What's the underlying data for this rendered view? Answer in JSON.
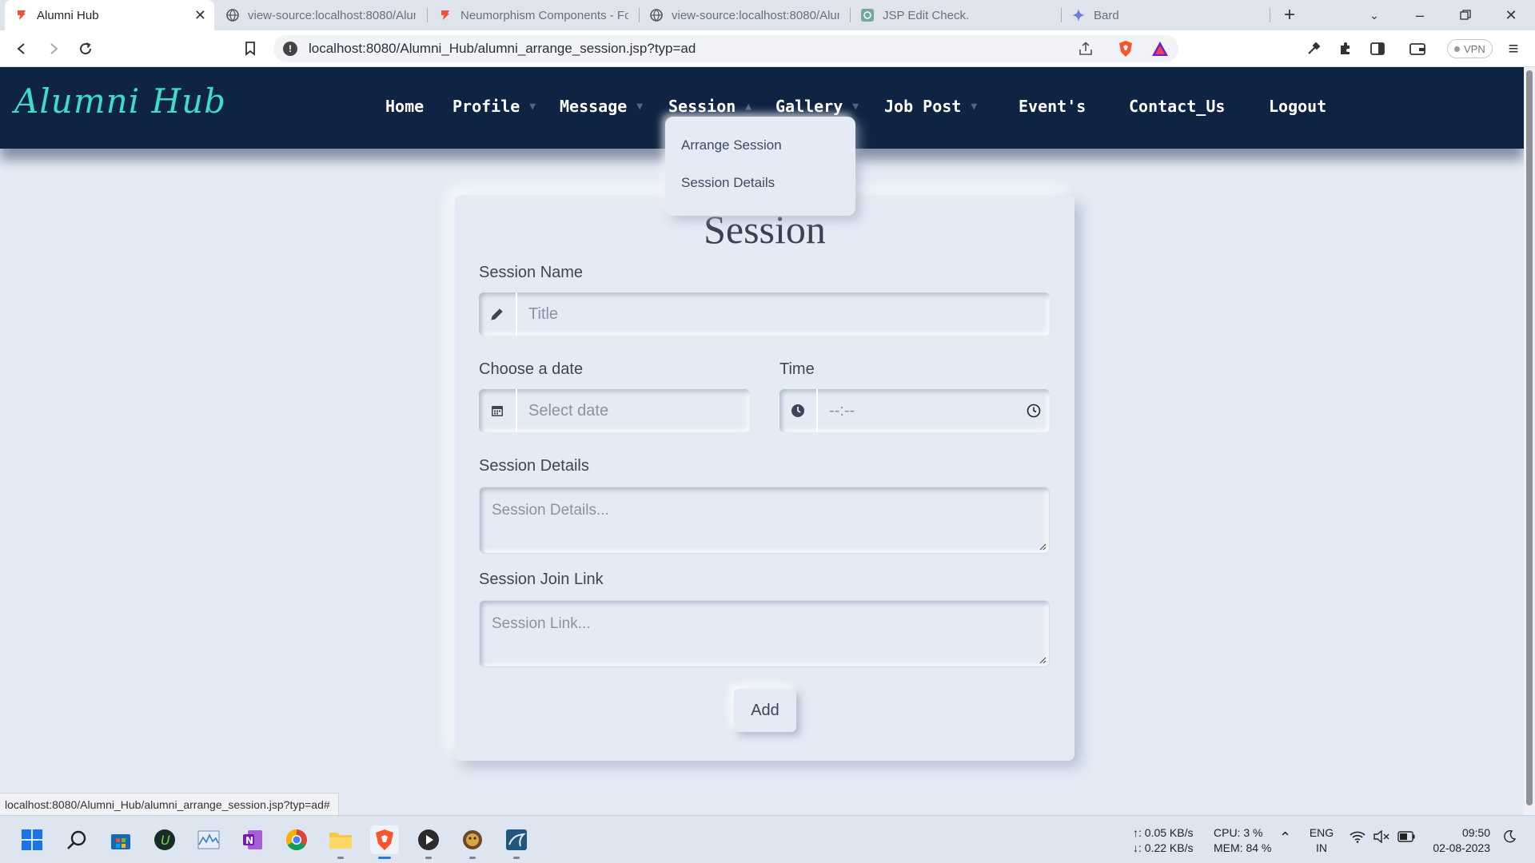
{
  "browser": {
    "tabs": [
      {
        "title": "Alumni Hub",
        "active": true
      },
      {
        "title": "view-source:localhost:8080/Alum"
      },
      {
        "title": "Neumorphism Components - Fo"
      },
      {
        "title": "view-source:localhost:8080/Alum"
      },
      {
        "title": "JSP Edit Check."
      },
      {
        "title": "Bard"
      }
    ],
    "url": "localhost:8080/Alumni_Hub/alumni_arrange_session.jsp?typ=ad",
    "vpn_label": "VPN",
    "status_url": "localhost:8080/Alumni_Hub/alumni_arrange_session.jsp?typ=ad#"
  },
  "site": {
    "logo": "Alumni Hub",
    "nav": [
      "Home",
      "Profile",
      "Message",
      "Session",
      "Gallery",
      "Job Post",
      "Event's",
      "Contact_Us",
      "Logout"
    ],
    "dropdown": [
      "Arrange Session",
      "Session Details"
    ]
  },
  "form": {
    "title": "Session",
    "session_name_label": "Session Name",
    "session_name_placeholder": "Title",
    "date_label": "Choose a date",
    "date_placeholder": "Select date",
    "time_label": "Time",
    "time_placeholder": "--:--",
    "details_label": "Session Details",
    "details_placeholder": "Session Details...",
    "link_label": "Session Join Link",
    "link_placeholder": "Session Link...",
    "add_button": "Add"
  },
  "taskbar": {
    "net_up": "↑: 0.05 KB/s",
    "net_down": "↓: 0.22 KB/s",
    "cpu": "CPU: 3 %",
    "mem": "MEM: 84 %",
    "lang": "ENG",
    "region": "IN",
    "time": "09:50",
    "date": "02-08-2023"
  },
  "colors": {
    "header_bg": "#0f2442",
    "logo": "#3ddbd0",
    "page_bg": "#e4ebf5"
  }
}
